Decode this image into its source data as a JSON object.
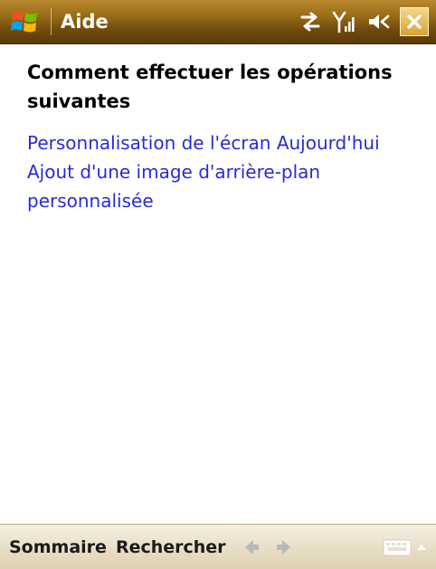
{
  "window": {
    "title": "Aide",
    "accent_color": "#8a5e14",
    "icons": {
      "start": "windows-flag-icon",
      "connectivity": "connectivity-arrows-icon",
      "signal": "signal-strength-icon",
      "volume": "speaker-volume-icon",
      "close": "close-icon"
    }
  },
  "content": {
    "heading": "Comment effectuer les opérations suivantes",
    "links": [
      {
        "label": "Personnalisation de l'écran Aujourd'hui"
      },
      {
        "label": "Ajout d'une image d'arrière-plan personnalisée"
      }
    ],
    "link_color": "#2a2ad8"
  },
  "menubar": {
    "left_label": "Sommaire",
    "right_label": "Rechercher",
    "icons": {
      "back": "back-arrow-icon",
      "forward": "forward-arrow-icon",
      "keyboard": "keyboard-icon",
      "sip_menu": "up-arrow-icon"
    }
  }
}
